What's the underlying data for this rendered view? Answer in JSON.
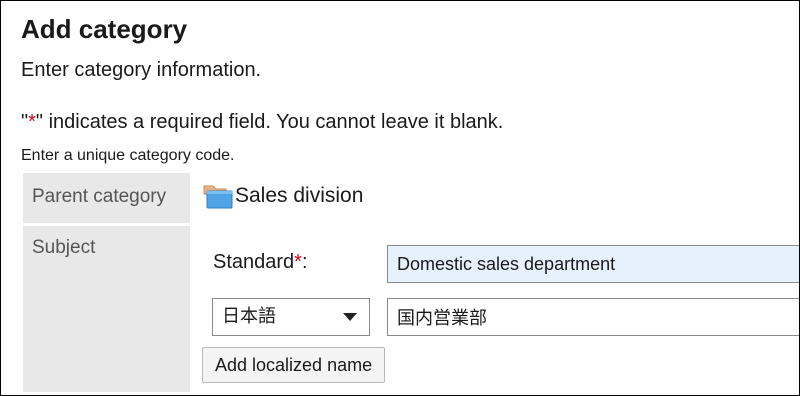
{
  "page": {
    "title": "Add category",
    "description": "Enter category information."
  },
  "notes": {
    "required_prefix": "\"",
    "required_star": "*",
    "required_suffix": "\" indicates a required field. You cannot leave it blank.",
    "unique_code": "Enter a unique category code."
  },
  "form": {
    "parent_category_label": "Parent category",
    "parent_category_value": "Sales division",
    "folder_icon": "folder-icon",
    "subject_label": "Subject",
    "standard_label": "Standard",
    "standard_star": "*",
    "standard_colon": ":",
    "standard_value": "Domestic sales department",
    "language_selected": "日本語",
    "localized_value": "国内営業部",
    "add_localized_label": "Add localized name"
  },
  "colors": {
    "required_star": "#d0021b",
    "label_bg": "#e8e8e8",
    "focused_input_bg": "#e7f0fd"
  }
}
